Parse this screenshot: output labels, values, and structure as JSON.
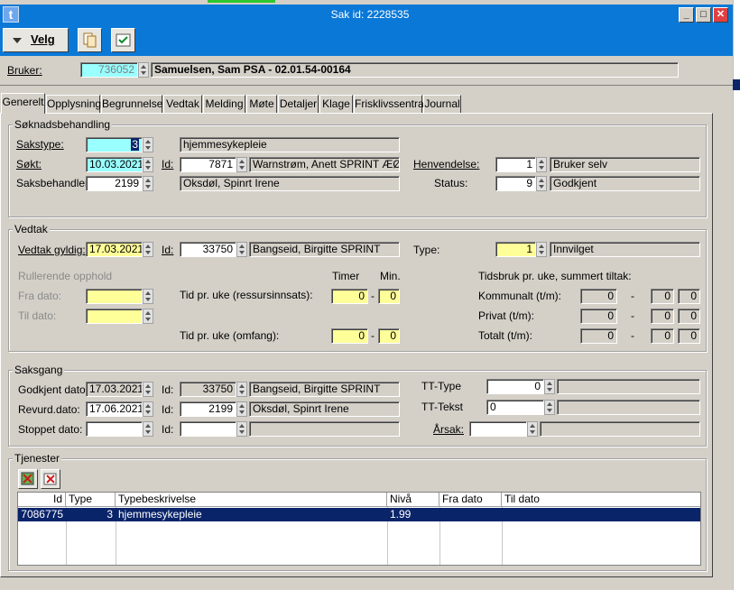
{
  "window": {
    "title": "Sak  id: 2228535",
    "app_icon": "t"
  },
  "toolbar": {
    "velg_label": "Velg",
    "icons": [
      "copy-icon",
      "approve-icon"
    ]
  },
  "bruker": {
    "label": "Bruker:",
    "id": "736052",
    "name": "Samuelsen, Sam PSA - 02.01.54-00164"
  },
  "tabs": [
    "Generelt",
    "Opplysning",
    "Begrunnelse",
    "Vedtak",
    "Melding",
    "Møte",
    "Detaljer",
    "Klage",
    "Frisklivssentral",
    "Journal"
  ],
  "soknad": {
    "title": "Søknadsbehandling",
    "sakstype_label": "Sakstype:",
    "sakstype_value": "3",
    "sakstype_text": "hjemmesykepleie",
    "sokt_label": "Søkt:",
    "sokt_value": "10.03.2021",
    "id_label": "Id:",
    "sokt_id": "7871",
    "sokt_person": "Warnstrøm, Anett SPRINT ÆØÅÄ",
    "henvendelse_label": "Henvendelse:",
    "henvendelse_value": "1",
    "henvendelse_text": "Bruker selv",
    "saksbehandler_label": "Saksbehandler:",
    "saksbehandler_value": "2199",
    "saksbehandler_text": "Oksdøl, Spinrt Irene",
    "status_label": "Status:",
    "status_value": "9",
    "status_text": "Godkjent"
  },
  "vedtak": {
    "title": "Vedtak",
    "gyldig_label": "Vedtak gyldig:",
    "gyldig_value": "17.03.2021",
    "id_label": "Id:",
    "id_value": "33750",
    "person": "Bangseid, Birgitte SPRINT",
    "type_label": "Type:",
    "type_value": "1",
    "type_text": "Innvilget",
    "rullerende_label": "Rullerende opphold",
    "fra_label": "Fra dato:",
    "til_label": "Til dato:",
    "timer_label": "Timer",
    "min_label": "Min.",
    "tid_ressurs_label": "Tid pr. uke (ressursinnsats):",
    "tid_ressurs_timer": "0",
    "tid_ressurs_min": "0",
    "tid_omfang_label": "Tid pr. uke (omfang):",
    "tid_omfang_timer": "0",
    "tid_omfang_min": "0",
    "tidsbruk_label": "Tidsbruk pr. uke, summert tiltak:",
    "kommunalt_label": "Kommunalt (t/m):",
    "kommunalt": [
      "0",
      "0",
      "0"
    ],
    "privat_label": "Privat (t/m):",
    "privat": [
      "0",
      "0",
      "0"
    ],
    "totalt_label": "Totalt (t/m):",
    "totalt": [
      "0",
      "0",
      "0"
    ],
    "sep": "-"
  },
  "saksgang": {
    "title": "Saksgang",
    "godkjent_label": "Godkjent dato:",
    "godkjent_value": "17.03.2021",
    "godkjent_id": "33750",
    "godkjent_person": "Bangseid, Birgitte SPRINT",
    "revurd_label": "Revurd.dato:",
    "revurd_value": "17.06.2021",
    "revurd_id": "2199",
    "revurd_person": "Oksdøl, Spinrt Irene",
    "stoppet_label": "Stoppet dato:",
    "id_label": "Id:",
    "tt_type_label": "TT-Type",
    "tt_type_value": "0",
    "tt_tekst_label": "TT-Tekst",
    "tt_tekst_value": "0",
    "arsak_label": "Årsak:"
  },
  "tjenester": {
    "title": "Tjenester",
    "columns": [
      "Id",
      "Type",
      "Typebeskrivelse",
      "Nivå",
      "Fra dato",
      "Til dato"
    ],
    "rows": [
      {
        "id": "7086775",
        "type": "3",
        "beskrivelse": "hjemmesykepleie",
        "niva": "1.99",
        "fra": "",
        "til": ""
      }
    ]
  },
  "colors": {
    "accent": "#0a78d7",
    "selected_row": "#0a246a",
    "yellow_field": "#ffff99",
    "cyan_field": "#99ffff"
  }
}
